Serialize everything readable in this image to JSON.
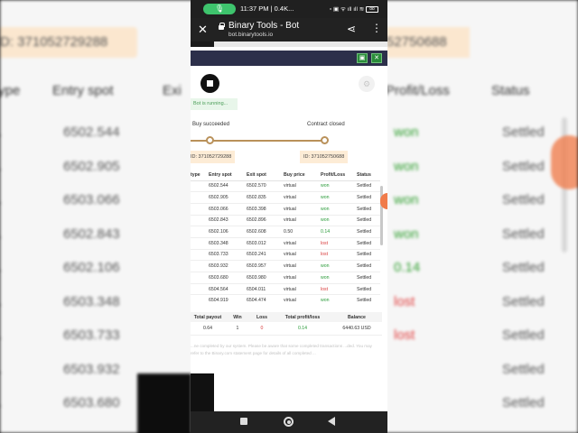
{
  "status_bar": {
    "time": "11:37 PM | 0.4K...",
    "right_info": "▫ ▣ ᯤ ıll ıll ≋",
    "battery": "88"
  },
  "browser": {
    "title": "Binary Tools - Bot",
    "url": "bot.binarytools.io",
    "icons": [
      "close-icon",
      "lock-icon",
      "share-icon",
      "more-vert-icon"
    ]
  },
  "bot": {
    "status": "Bot is running...",
    "step_left": "Buy succeeded",
    "step_right": "Contract closed",
    "progress": 1.0,
    "id_left": "ID: 371052729288",
    "id_right": "ID: 371052750688"
  },
  "trades": {
    "headers": [
      "type",
      "Entry spot",
      "Exit spot",
      "Buy price",
      "Profit/Loss",
      "Status"
    ],
    "rows": [
      [
        "",
        "6502.544",
        "6502.570",
        "virtual",
        "won",
        "Settled"
      ],
      [
        "",
        "6502.905",
        "6502.835",
        "virtual",
        "won",
        "Settled"
      ],
      [
        "",
        "6503.066",
        "6503.398",
        "virtual",
        "won",
        "Settled"
      ],
      [
        "",
        "6502.843",
        "6502.896",
        "virtual",
        "won",
        "Settled"
      ],
      [
        "",
        "6502.106",
        "6502.608",
        "0.50",
        "0.14",
        "Settled"
      ],
      [
        "",
        "6503.348",
        "6503.012",
        "virtual",
        "lost",
        "Settled"
      ],
      [
        "",
        "6503.733",
        "6503.241",
        "virtual",
        "lost",
        "Settled"
      ],
      [
        "",
        "6503.932",
        "6503.957",
        "virtual",
        "won",
        "Settled"
      ],
      [
        "",
        "6503.680",
        "6503.980",
        "virtual",
        "won",
        "Settled"
      ],
      [
        "",
        "6504.564",
        "6504.011",
        "virtual",
        "lost",
        "Settled"
      ],
      [
        "",
        "6504.919",
        "6504.474",
        "virtual",
        "won",
        "Settled"
      ]
    ]
  },
  "summary": {
    "headers": [
      "Total payout",
      "Win",
      "Loss",
      "Total profit/loss",
      "Balance"
    ],
    "values": [
      "0.64",
      "1",
      "0",
      "0.14",
      "6440.63 USD"
    ]
  },
  "note": "...ne completed by our system. Please be aware that some completed transactions ...ded. You may refer to the Binary.com statement page for details of all completed ...",
  "background": {
    "id_left": "D: 371052729288",
    "id_right": "52750688",
    "headers": [
      "type",
      "Entry spot",
      "Profit/Loss",
      "Status"
    ],
    "entry_spots": [
      "6502.544",
      "6502.905",
      "6503.066",
      "6502.843",
      "6502.106",
      "6503.348",
      "6503.733",
      "6503.932",
      "6503.680"
    ],
    "profits": [
      "won",
      "won",
      "won",
      "won",
      "0.14",
      "lost",
      "lost",
      "",
      ""
    ],
    "status": "Settled"
  },
  "colors": {
    "won": "#2b9b3a",
    "lost": "#d83b3b",
    "toolbar": "#2c2f4a",
    "progress": "#b9915a",
    "id_bg": "#fdecd6"
  }
}
